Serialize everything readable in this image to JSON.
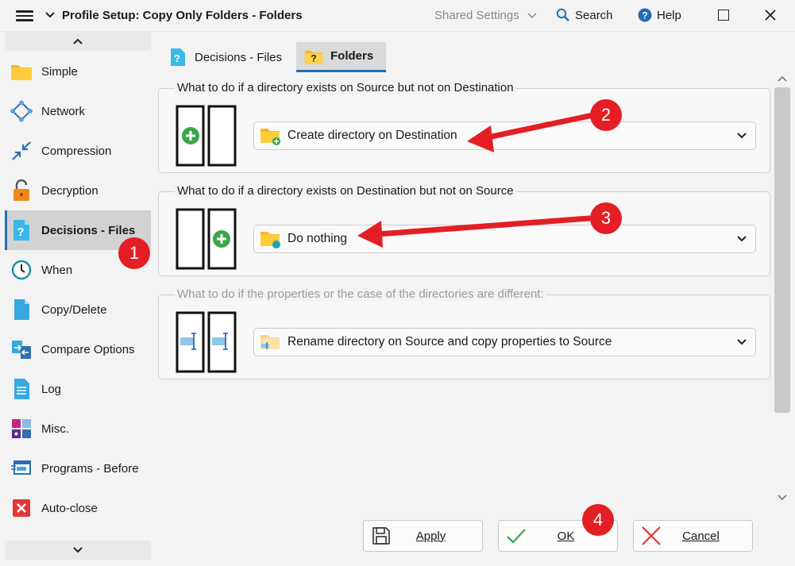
{
  "window": {
    "title": "Profile Setup: Copy Only Folders - Folders",
    "shared_settings": "Shared Settings",
    "search": "Search",
    "help": "Help"
  },
  "sidebar": {
    "items": [
      {
        "label": "Simple",
        "icon": "folder-icon"
      },
      {
        "label": "Network",
        "icon": "network-icon"
      },
      {
        "label": "Compression",
        "icon": "compression-icon"
      },
      {
        "label": "Decryption",
        "icon": "lock-open-icon"
      },
      {
        "label": "Decisions - Files",
        "icon": "question-file-icon",
        "active": true
      },
      {
        "label": "When",
        "icon": "clock-icon"
      },
      {
        "label": "Copy/Delete",
        "icon": "copy-icon"
      },
      {
        "label": "Compare Options",
        "icon": "compare-icon"
      },
      {
        "label": "Log",
        "icon": "log-icon"
      },
      {
        "label": "Misc.",
        "icon": "misc-icon"
      },
      {
        "label": "Programs - Before",
        "icon": "programs-icon"
      },
      {
        "label": "Auto-close",
        "icon": "close-red-icon"
      }
    ]
  },
  "tabs": [
    {
      "label": "Decisions - Files",
      "icon": "question-file-icon"
    },
    {
      "label": "Folders",
      "icon": "question-folder-icon",
      "active": true
    }
  ],
  "groups": [
    {
      "legend": "What to do if a directory exists on Source but not on Destination",
      "value": "Create directory on Destination"
    },
    {
      "legend": "What to do if a directory exists on Destination but not on Source",
      "value": "Do nothing"
    },
    {
      "legend": "What to do if the properties or the case of the directories are different:",
      "value": "Rename directory on Source and copy properties to Source"
    }
  ],
  "buttons": {
    "apply": "Apply",
    "ok": "OK",
    "cancel": "Cancel"
  },
  "callouts": [
    "1",
    "2",
    "3",
    "4"
  ],
  "colors": {
    "accent": "#1f6fb6",
    "callout": "#e31e24",
    "plus_green": "#3aa64a"
  }
}
